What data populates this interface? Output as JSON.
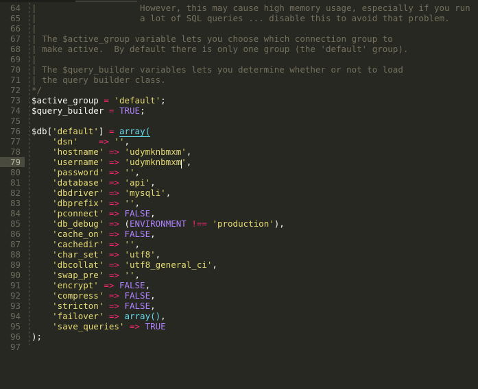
{
  "editor": {
    "theme_name": "monokai",
    "background": "#272822",
    "gutter_color": "#6b6b5e",
    "active_line_gutter_bg": "#4a4a3f",
    "active_line_number": 79,
    "first_visible_line": 64,
    "last_visible_line": 97,
    "colors": {
      "comment": "#75715e",
      "plain": "#f8f8f2",
      "operator": "#f92672",
      "string": "#e6db74",
      "constant": "#ae81ff",
      "function": "#66d9ef"
    },
    "caret_icon": "text-caret"
  },
  "lines": [
    {
      "n": "64",
      "tokens": [
        {
          "t": "comment",
          "s": "|                    However, this may cause high memory usage, especially if you run"
        }
      ]
    },
    {
      "n": "65",
      "tokens": [
        {
          "t": "comment",
          "s": "|                    a lot of SQL queries ... disable this to avoid that problem."
        }
      ]
    },
    {
      "n": "66",
      "tokens": [
        {
          "t": "comment",
          "s": "|"
        }
      ]
    },
    {
      "n": "67",
      "tokens": [
        {
          "t": "comment",
          "s": "| The $active_group variable lets you choose which connection group to"
        }
      ]
    },
    {
      "n": "68",
      "tokens": [
        {
          "t": "comment",
          "s": "| make active.  By default there is only one group (the 'default' group)."
        }
      ]
    },
    {
      "n": "69",
      "tokens": [
        {
          "t": "comment",
          "s": "|"
        }
      ]
    },
    {
      "n": "70",
      "tokens": [
        {
          "t": "comment",
          "s": "| The $query_builder variables lets you determine whether or not to load"
        }
      ]
    },
    {
      "n": "71",
      "tokens": [
        {
          "t": "comment",
          "s": "| the query builder class."
        }
      ]
    },
    {
      "n": "72",
      "tokens": [
        {
          "t": "comment",
          "s": "*/"
        }
      ]
    },
    {
      "n": "73",
      "tokens": [
        {
          "t": "var",
          "s": "$active_group "
        },
        {
          "t": "op",
          "s": "="
        },
        {
          "t": "string",
          "s": " 'default'"
        },
        {
          "t": "plain",
          "s": ";"
        }
      ]
    },
    {
      "n": "74",
      "tokens": [
        {
          "t": "var",
          "s": "$query_builder "
        },
        {
          "t": "op",
          "s": "="
        },
        {
          "t": "const",
          "s": " TRUE"
        },
        {
          "t": "plain",
          "s": ";"
        }
      ]
    },
    {
      "n": "75",
      "tokens": []
    },
    {
      "n": "76",
      "tokens": [
        {
          "t": "var",
          "s": "$db"
        },
        {
          "t": "punc",
          "s": "["
        },
        {
          "t": "string",
          "s": "'default'"
        },
        {
          "t": "punc",
          "s": "] "
        },
        {
          "t": "op",
          "s": "="
        },
        {
          "t": "plain",
          "s": " "
        },
        {
          "t": "fn-under",
          "s": "array("
        }
      ]
    },
    {
      "n": "77",
      "tokens": [
        {
          "t": "string",
          "s": "\t'dsn'    "
        },
        {
          "t": "op",
          "s": "=>"
        },
        {
          "t": "string",
          "s": " ''"
        },
        {
          "t": "plain",
          "s": ","
        }
      ]
    },
    {
      "n": "78",
      "tokens": [
        {
          "t": "string",
          "s": "\t'hostname' "
        },
        {
          "t": "op",
          "s": "=>"
        },
        {
          "t": "string",
          "s": " 'udymknbmxm'"
        },
        {
          "t": "plain",
          "s": ","
        }
      ]
    },
    {
      "n": "79",
      "active": true,
      "tokens": [
        {
          "t": "string",
          "s": "\t'username' "
        },
        {
          "t": "op",
          "s": "=>"
        },
        {
          "t": "string",
          "s": " 'udymknbmxm"
        },
        {
          "t": "caret",
          "s": ""
        },
        {
          "t": "string",
          "s": "'"
        },
        {
          "t": "plain",
          "s": ","
        }
      ]
    },
    {
      "n": "80",
      "tokens": [
        {
          "t": "string",
          "s": "\t'password' "
        },
        {
          "t": "op",
          "s": "=>"
        },
        {
          "t": "string",
          "s": " ''"
        },
        {
          "t": "plain",
          "s": ","
        }
      ]
    },
    {
      "n": "81",
      "tokens": [
        {
          "t": "string",
          "s": "\t'database' "
        },
        {
          "t": "op",
          "s": "=>"
        },
        {
          "t": "string",
          "s": " 'api'"
        },
        {
          "t": "plain",
          "s": ","
        }
      ]
    },
    {
      "n": "82",
      "tokens": [
        {
          "t": "string",
          "s": "\t'dbdriver' "
        },
        {
          "t": "op",
          "s": "=>"
        },
        {
          "t": "string",
          "s": " 'mysqli'"
        },
        {
          "t": "plain",
          "s": ","
        }
      ]
    },
    {
      "n": "83",
      "tokens": [
        {
          "t": "string",
          "s": "\t'dbprefix' "
        },
        {
          "t": "op",
          "s": "=>"
        },
        {
          "t": "string",
          "s": " ''"
        },
        {
          "t": "plain",
          "s": ","
        }
      ]
    },
    {
      "n": "84",
      "tokens": [
        {
          "t": "string",
          "s": "\t'pconnect' "
        },
        {
          "t": "op",
          "s": "=>"
        },
        {
          "t": "const",
          "s": " FALSE"
        },
        {
          "t": "plain",
          "s": ","
        }
      ]
    },
    {
      "n": "85",
      "tokens": [
        {
          "t": "string",
          "s": "\t'db_debug' "
        },
        {
          "t": "op",
          "s": "=>"
        },
        {
          "t": "plain",
          "s": " ("
        },
        {
          "t": "ident",
          "s": "ENVIRONMENT"
        },
        {
          "t": "op",
          "s": " !=="
        },
        {
          "t": "string",
          "s": " 'production'"
        },
        {
          "t": "plain",
          "s": "),"
        }
      ]
    },
    {
      "n": "86",
      "tokens": [
        {
          "t": "string",
          "s": "\t'cache_on' "
        },
        {
          "t": "op",
          "s": "=>"
        },
        {
          "t": "const",
          "s": " FALSE"
        },
        {
          "t": "plain",
          "s": ","
        }
      ]
    },
    {
      "n": "87",
      "tokens": [
        {
          "t": "string",
          "s": "\t'cachedir' "
        },
        {
          "t": "op",
          "s": "=>"
        },
        {
          "t": "string",
          "s": " ''"
        },
        {
          "t": "plain",
          "s": ","
        }
      ]
    },
    {
      "n": "88",
      "tokens": [
        {
          "t": "string",
          "s": "\t'char_set' "
        },
        {
          "t": "op",
          "s": "=>"
        },
        {
          "t": "string",
          "s": " 'utf8'"
        },
        {
          "t": "plain",
          "s": ","
        }
      ]
    },
    {
      "n": "89",
      "tokens": [
        {
          "t": "string",
          "s": "\t'dbcollat' "
        },
        {
          "t": "op",
          "s": "=>"
        },
        {
          "t": "string",
          "s": " 'utf8_general_ci'"
        },
        {
          "t": "plain",
          "s": ","
        }
      ]
    },
    {
      "n": "90",
      "tokens": [
        {
          "t": "string",
          "s": "\t'swap_pre' "
        },
        {
          "t": "op",
          "s": "=>"
        },
        {
          "t": "string",
          "s": " ''"
        },
        {
          "t": "plain",
          "s": ","
        }
      ]
    },
    {
      "n": "91",
      "tokens": [
        {
          "t": "string",
          "s": "\t'encrypt' "
        },
        {
          "t": "op",
          "s": "=>"
        },
        {
          "t": "const",
          "s": " FALSE"
        },
        {
          "t": "plain",
          "s": ","
        }
      ]
    },
    {
      "n": "92",
      "tokens": [
        {
          "t": "string",
          "s": "\t'compress' "
        },
        {
          "t": "op",
          "s": "=>"
        },
        {
          "t": "const",
          "s": " FALSE"
        },
        {
          "t": "plain",
          "s": ","
        }
      ]
    },
    {
      "n": "93",
      "tokens": [
        {
          "t": "string",
          "s": "\t'stricton' "
        },
        {
          "t": "op",
          "s": "=>"
        },
        {
          "t": "const",
          "s": " FALSE"
        },
        {
          "t": "plain",
          "s": ","
        }
      ]
    },
    {
      "n": "94",
      "tokens": [
        {
          "t": "string",
          "s": "\t'failover' "
        },
        {
          "t": "op",
          "s": "=>"
        },
        {
          "t": "func",
          "s": " array()"
        },
        {
          "t": "plain",
          "s": ","
        }
      ]
    },
    {
      "n": "95",
      "tokens": [
        {
          "t": "string",
          "s": "\t'save_queries' "
        },
        {
          "t": "op",
          "s": "=>"
        },
        {
          "t": "const",
          "s": " TRUE"
        }
      ]
    },
    {
      "n": "96",
      "tokens": [
        {
          "t": "plain",
          "s": ");"
        }
      ]
    },
    {
      "n": "97",
      "tokens": []
    }
  ]
}
